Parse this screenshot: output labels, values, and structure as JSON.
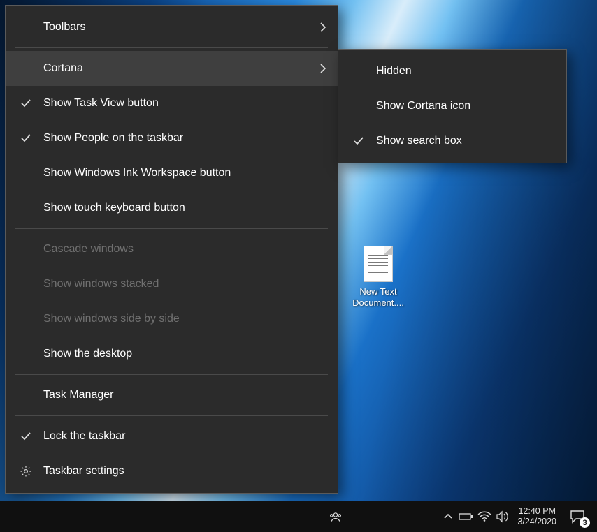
{
  "menu": {
    "toolbars": "Toolbars",
    "cortana": "Cortana",
    "show_task_view": "Show Task View button",
    "show_people": "Show People on the taskbar",
    "show_ink": "Show Windows Ink Workspace button",
    "show_touch_keyboard": "Show touch keyboard button",
    "cascade": "Cascade windows",
    "stacked": "Show windows stacked",
    "side_by_side": "Show windows side by side",
    "show_desktop": "Show the desktop",
    "task_manager": "Task Manager",
    "lock_taskbar": "Lock the taskbar",
    "taskbar_settings": "Taskbar settings"
  },
  "cortana_submenu": {
    "hidden": "Hidden",
    "show_icon": "Show Cortana icon",
    "show_search_box": "Show search box"
  },
  "desktop": {
    "file_label": "New Text Document...."
  },
  "taskbar": {
    "time": "12:40 PM",
    "date": "3/24/2020",
    "notifications": "3"
  }
}
